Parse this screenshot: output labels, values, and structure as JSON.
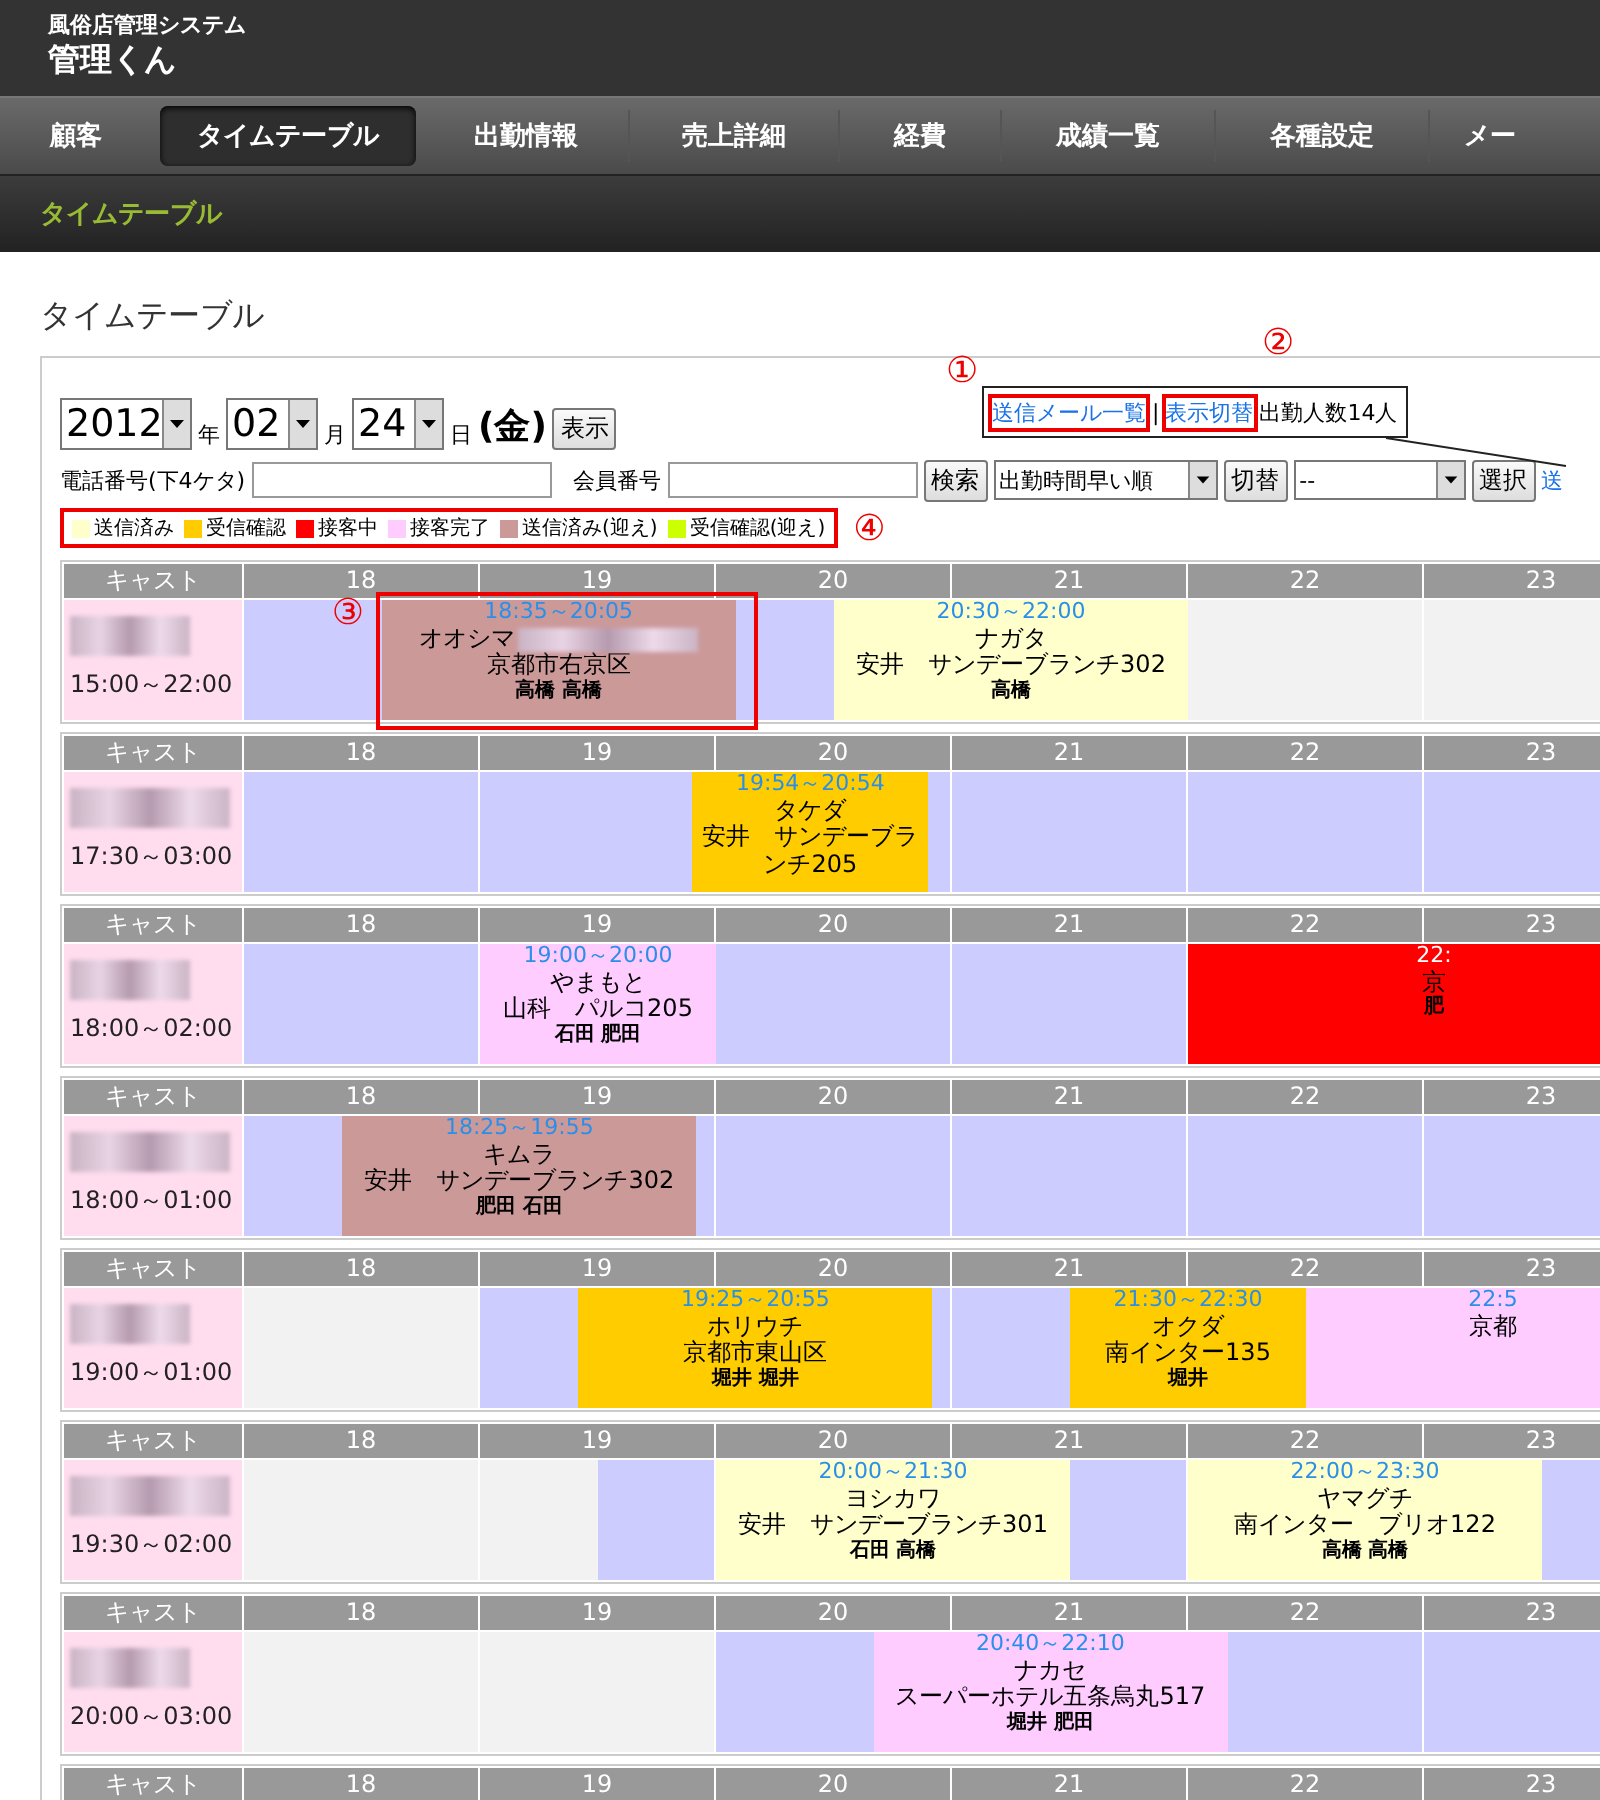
{
  "header": {
    "subtitle": "風俗店管理システム",
    "title": "管理くん"
  },
  "nav": [
    {
      "label": "顧客",
      "selected": false
    },
    {
      "label": "タイムテーブル",
      "selected": true
    },
    {
      "label": "出勤情報",
      "selected": false
    },
    {
      "label": "売上詳細",
      "selected": false
    },
    {
      "label": "経費",
      "selected": false
    },
    {
      "label": "成績一覧",
      "selected": false
    },
    {
      "label": "各種設定",
      "selected": false
    },
    {
      "label": "メー",
      "selected": false
    }
  ],
  "breadcrumb": "タイムテーブル",
  "page_title": "タイムテーブル",
  "date": {
    "year": "2012",
    "year_label": "年",
    "month": "02",
    "month_label": "月",
    "day": "24",
    "day_label": "日",
    "weekday": "(金)",
    "show_button": "表示"
  },
  "info": {
    "links": [
      {
        "label": "送信メール一覧",
        "annotation": "①"
      },
      {
        "label": "表示切替",
        "annotation": "②"
      }
    ],
    "separator": "|",
    "staff_count": "出勤人数14人"
  },
  "search": {
    "phone_label": "電話番号(下4ケタ)",
    "member_label": "会員番号",
    "search_button": "検索",
    "sort_value": "出勤時間早い順",
    "switch_button": "切替",
    "filter_value": "--",
    "select_button": "選択",
    "cut_link": "送"
  },
  "legend": {
    "annotation": "④",
    "items": [
      {
        "kind": "sent",
        "label": "送信済み",
        "color": "#ffffcc"
      },
      {
        "kind": "received",
        "label": "受信確認",
        "color": "#ffcc00"
      },
      {
        "kind": "serving",
        "label": "接客中",
        "color": "#ff0000"
      },
      {
        "kind": "done",
        "label": "接客完了",
        "color": "#ffccff"
      },
      {
        "kind": "sent_pickup",
        "label": "送信済み(迎え)",
        "color": "#cc9999"
      },
      {
        "kind": "received_pickup",
        "label": "受信確認(迎え)",
        "color": "#ccff00"
      }
    ]
  },
  "casts": [
    {
      "header": [
        "キャスト",
        "18",
        "19",
        "20",
        "21",
        "22",
        "23"
      ],
      "shift": "15:00～22:00",
      "bookings": [
        {
          "kind": "sent_pickup",
          "time": "18:35～20:05",
          "name": "オオシマ",
          "blurred": true,
          "address": "京都市右京区",
          "staff": "高橋 高橋",
          "annotation": "③"
        },
        {
          "kind": "sent",
          "time": "20:30～22:00",
          "name": "ナガタ",
          "blurred": false,
          "address": "安井　サンデーブランチ302",
          "staff": "高橋"
        }
      ]
    },
    {
      "header": [
        "キャスト",
        "18",
        "19",
        "20",
        "21",
        "22",
        "23"
      ],
      "shift": "17:30～03:00",
      "bookings": [
        {
          "kind": "received",
          "time": "19:54～20:54",
          "name": "タケダ",
          "blurred": false,
          "address": "安井　サンデーブランチ205"
        }
      ]
    },
    {
      "header": [
        "キャスト",
        "18",
        "19",
        "20",
        "21",
        "22",
        "23"
      ],
      "shift": "18:00～02:00",
      "bookings": [
        {
          "kind": "done",
          "time": "19:00～20:00",
          "name": "やまもと",
          "blurred": false,
          "address": "山科　パルコ205",
          "staff": "石田 肥田"
        },
        {
          "kind": "serving",
          "time": "22:",
          "blurred": false,
          "address": "京",
          "staff": "肥"
        }
      ]
    },
    {
      "header": [
        "キャスト",
        "18",
        "19",
        "20",
        "21",
        "22",
        "23"
      ],
      "shift": "18:00～01:00",
      "bookings": [
        {
          "kind": "sent_pickup",
          "time": "18:25～19:55",
          "name": "キムラ",
          "blurred": false,
          "address": "安井　サンデーブランチ302",
          "staff": "肥田 石田"
        }
      ]
    },
    {
      "header": [
        "キャスト",
        "18",
        "19",
        "20",
        "21",
        "22",
        "23"
      ],
      "shift": "19:00～01:00",
      "bookings": [
        {
          "kind": "received",
          "time": "19:25～20:55",
          "name": "ホリウチ",
          "blurred": false,
          "address": "京都市東山区",
          "staff": "堀井 堀井"
        },
        {
          "kind": "received",
          "time": "21:30～22:30",
          "name": "オクダ",
          "blurred": false,
          "address": "南インター135",
          "staff": "堀井"
        },
        {
          "kind": "done",
          "time": "22:5",
          "blurred": false,
          "address": "京都"
        }
      ]
    },
    {
      "header": [
        "キャスト",
        "18",
        "19",
        "20",
        "21",
        "22",
        "23"
      ],
      "shift": "19:30～02:00",
      "bookings": [
        {
          "kind": "sent",
          "time": "20:00～21:30",
          "name": "ヨシカワ",
          "blurred": false,
          "address": "安井　サンデーブランチ301",
          "staff": "石田 高橋"
        },
        {
          "kind": "sent",
          "time": "22:00～23:30",
          "name": "ヤマグチ",
          "blurred": false,
          "address": "南インター　ブリオ122",
          "staff": "高橋 高橋"
        }
      ]
    },
    {
      "header": [
        "キャスト",
        "18",
        "19",
        "20",
        "21",
        "22",
        "23"
      ],
      "shift": "20:00～03:00",
      "bookings": [
        {
          "kind": "done",
          "time": "20:40～22:10",
          "name": "ナカセ",
          "blurred": false,
          "address": "スーパーホテル五条烏丸517",
          "staff": "堀井 肥田"
        }
      ]
    },
    {
      "header": [
        "キャスト",
        "18",
        "19",
        "20",
        "21",
        "22",
        "23"
      ]
    }
  ]
}
